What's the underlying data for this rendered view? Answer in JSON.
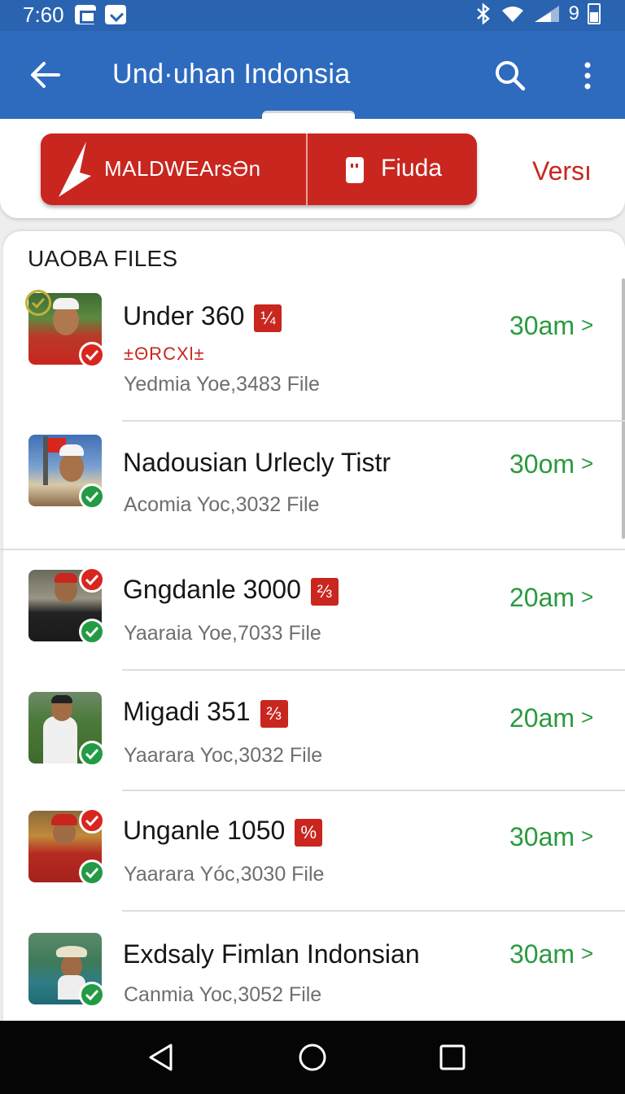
{
  "status_bar": {
    "time": "7:60",
    "signal_text": "9",
    "icons": [
      "notification-icon",
      "message-icon",
      "bluetooth-icon",
      "wifi-icon",
      "signal-icon",
      "battery-icon"
    ]
  },
  "app_bar": {
    "title": "Und·uhan Indonsia",
    "back_icon": "arrow-left-icon",
    "search_icon": "search-icon",
    "more_icon": "more-vert-icon"
  },
  "filters": {
    "segment_left_label": "MALDWEArsƏn",
    "segment_right_label": "Fiuda",
    "version_label": "Versı"
  },
  "list": {
    "heading": "UAOBA FILES",
    "items": [
      {
        "title": "Under 360",
        "tag": "¼",
        "subtitle": "±ΘRCXl±",
        "meta": "Yedmia Yoe,3483 File",
        "time": "30am",
        "thumb_badges": [
          "ring",
          "red"
        ]
      },
      {
        "title": "Nadousian Urlecly Tistr",
        "tag": "",
        "subtitle": "",
        "meta": "Acomia Yoc,3032 File",
        "time": "30om",
        "thumb_badges": [
          "green"
        ]
      },
      {
        "title": "Gngdanle 3000",
        "tag": "⅔",
        "subtitle": "",
        "meta": "Yaaraia Yoe,7033 File",
        "time": "20am",
        "thumb_badges": [
          "red",
          "green"
        ]
      },
      {
        "title": "Migadi 351",
        "tag": "⅔",
        "subtitle": "",
        "meta": "Yaarara Yoc,3032 File",
        "time": "20am",
        "thumb_badges": [
          "green"
        ]
      },
      {
        "title": "Unganle 1050",
        "tag": "%",
        "subtitle": "",
        "meta": "Yaarara Yóc,3030 File",
        "time": "30am",
        "thumb_badges": [
          "red",
          "green"
        ]
      },
      {
        "title": "Exdsaly Fimlan Indonsian",
        "tag": "",
        "subtitle": "",
        "meta": "Canmia Yoc,3052 File",
        "time": "30am",
        "thumb_badges": [
          "green"
        ]
      }
    ]
  },
  "colors": {
    "app_bar": "#2e6bbf",
    "status_bar": "#2a63b0",
    "accent_red": "#c8261f",
    "time_green": "#2a9a3e",
    "check_green": "#239b45"
  },
  "nav_bar": {
    "buttons": [
      "back-triangle-icon",
      "home-circle-icon",
      "recents-square-icon"
    ]
  }
}
